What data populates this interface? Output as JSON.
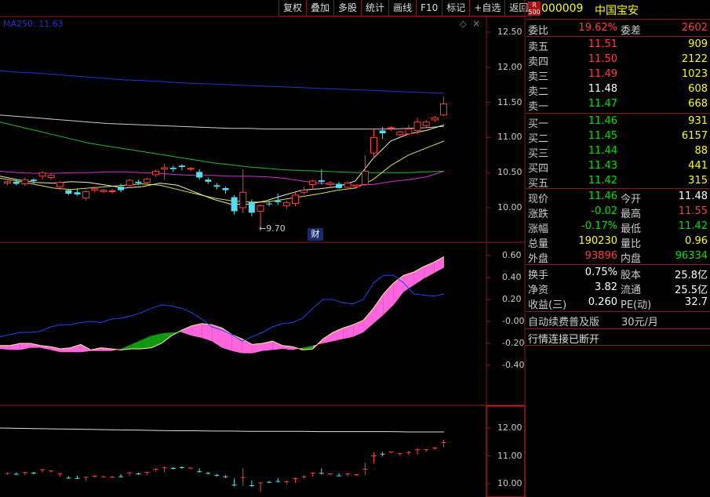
{
  "toolbar": [
    "复权",
    "叠加",
    "多股",
    "统计",
    "画线",
    "F10",
    "标记",
    "+自选",
    "返回"
  ],
  "stock": {
    "badge_top": "R",
    "badge_bottom": "500",
    "code": "000009",
    "name": "中国宝安"
  },
  "ma_legend": "MA250: 11.63",
  "low_marker": "←9.70",
  "cai_badge": "财",
  "price_axis": [
    "12.50",
    "12.00",
    "11.50",
    "11.00",
    "10.50",
    "10.00"
  ],
  "indicator_axis": [
    "0.60",
    "0.40",
    "0.20",
    "-0.00",
    "-0.20",
    "-0.40"
  ],
  "volume_axis": [
    "12.00",
    "11.00",
    "10.00"
  ],
  "order_book": {
    "weibi": {
      "label": "委比",
      "value": "19.62%",
      "label2": "委差",
      "value2": "2602"
    },
    "asks": [
      {
        "label": "卖五",
        "price": "11.51",
        "vol": "909"
      },
      {
        "label": "卖四",
        "price": "11.50",
        "vol": "2122"
      },
      {
        "label": "卖三",
        "price": "11.49",
        "vol": "1023"
      },
      {
        "label": "卖二",
        "price": "11.48",
        "vol": "608"
      },
      {
        "label": "卖一",
        "price": "11.47",
        "vol": "668"
      }
    ],
    "bids": [
      {
        "label": "买一",
        "price": "11.46",
        "vol": "931"
      },
      {
        "label": "买二",
        "price": "11.45",
        "vol": "6157"
      },
      {
        "label": "买三",
        "price": "11.44",
        "vol": "88"
      },
      {
        "label": "买四",
        "price": "11.43",
        "vol": "441"
      },
      {
        "label": "买五",
        "price": "11.42",
        "vol": "315"
      }
    ]
  },
  "quote": {
    "xianjia": {
      "k": "现价",
      "v": "11.46",
      "k2": "今开",
      "v2": "11.48"
    },
    "zhangdie": {
      "k": "涨跌",
      "v": "-0.02",
      "k2": "最高",
      "v2": "11.55"
    },
    "zhangfu": {
      "k": "涨幅",
      "v": "-0.17%",
      "k2": "最低",
      "v2": "11.42"
    },
    "zongliang": {
      "k": "总量",
      "v": "190230",
      "k2": "量比",
      "v2": "0.96"
    },
    "waipan": {
      "k": "外盘",
      "v": "93896",
      "k2": "内盘",
      "v2": "96334"
    }
  },
  "fundamentals": {
    "huanshou": {
      "k": "换手",
      "v": "0.75%",
      "k2": "股本",
      "v2": "25.8亿"
    },
    "jingzi": {
      "k": "净资",
      "v": "3.82",
      "k2": "流通",
      "v2": "25.5亿"
    },
    "shouyi": {
      "k": "收益(三)",
      "v": "0.260",
      "k2": "PE(动)",
      "v2": "32.7"
    }
  },
  "promo": {
    "text": "自动续费普及版",
    "price": "30元/月"
  },
  "status": "行情连接已断开",
  "candles": [
    [
      10.35,
      10.37,
      10.32,
      10.39
    ],
    [
      10.37,
      10.34,
      10.32,
      10.4
    ],
    [
      10.34,
      10.4,
      10.31,
      10.43
    ],
    [
      10.4,
      10.38,
      10.33,
      10.42
    ],
    [
      10.45,
      10.5,
      10.4,
      10.52
    ],
    [
      10.43,
      10.46,
      10.4,
      10.48
    ],
    [
      10.3,
      10.36,
      10.25,
      10.38
    ],
    [
      10.25,
      10.2,
      10.18,
      10.27
    ],
    [
      10.22,
      10.19,
      10.17,
      10.28
    ],
    [
      10.14,
      10.23,
      10.1,
      10.25
    ],
    [
      10.25,
      10.27,
      10.22,
      10.3
    ],
    [
      10.23,
      10.25,
      10.21,
      10.27
    ],
    [
      10.23,
      10.24,
      10.2,
      10.27
    ],
    [
      10.3,
      10.25,
      10.22,
      10.34
    ],
    [
      10.32,
      10.39,
      10.28,
      10.41
    ],
    [
      10.37,
      10.35,
      10.32,
      10.4
    ],
    [
      10.36,
      10.41,
      10.31,
      10.43
    ],
    [
      10.47,
      10.52,
      10.44,
      10.54
    ],
    [
      10.55,
      10.57,
      10.4,
      10.63
    ],
    [
      10.57,
      10.55,
      10.51,
      10.6
    ],
    [
      10.6,
      10.58,
      10.53,
      10.62
    ],
    [
      10.55,
      10.56,
      10.52,
      10.58
    ],
    [
      10.51,
      10.43,
      10.4,
      10.55
    ],
    [
      10.4,
      10.37,
      10.34,
      10.43
    ],
    [
      10.32,
      10.3,
      10.26,
      10.35
    ],
    [
      10.28,
      10.25,
      10.2,
      10.3
    ],
    [
      10.15,
      9.95,
      9.9,
      10.18
    ],
    [
      10.0,
      10.22,
      9.92,
      10.55
    ],
    [
      10.08,
      9.93,
      9.88,
      10.12
    ],
    [
      9.95,
      10.03,
      9.7,
      10.05
    ],
    [
      10.06,
      10.05,
      10.02,
      10.1
    ],
    [
      10.1,
      10.08,
      10.04,
      10.2
    ],
    [
      10.03,
      10.07,
      9.98,
      10.1
    ],
    [
      10.06,
      10.18,
      10.02,
      10.22
    ],
    [
      10.22,
      10.25,
      10.19,
      10.3
    ],
    [
      10.33,
      10.38,
      10.26,
      10.4
    ],
    [
      10.39,
      10.37,
      10.33,
      10.55
    ],
    [
      10.33,
      10.35,
      10.3,
      10.38
    ],
    [
      10.34,
      10.28,
      10.27,
      10.37
    ],
    [
      10.29,
      10.35,
      10.26,
      10.38
    ],
    [
      10.3,
      10.32,
      10.27,
      10.33
    ],
    [
      10.33,
      10.52,
      10.31,
      10.75
    ],
    [
      10.78,
      11.0,
      10.73,
      11.12
    ],
    [
      11.1,
      11.06,
      10.98,
      11.15
    ],
    [
      11.13,
      11.14,
      11.09,
      11.16
    ],
    [
      11.04,
      11.08,
      11.0,
      11.1
    ],
    [
      11.05,
      11.12,
      11.03,
      11.18
    ],
    [
      11.1,
      11.22,
      11.04,
      11.28
    ],
    [
      11.17,
      11.22,
      11.14,
      11.25
    ],
    [
      11.25,
      11.28,
      11.22,
      11.31
    ],
    [
      11.32,
      11.48,
      11.3,
      11.58
    ]
  ],
  "lines": {
    "ma250": [
      11.95,
      11.93,
      11.92,
      11.9,
      11.88,
      11.86,
      11.84,
      11.82,
      11.81,
      11.8,
      11.78,
      11.77,
      11.76,
      11.75,
      11.74,
      11.73,
      11.72,
      11.71,
      11.7,
      11.69,
      11.68,
      11.67,
      11.66,
      11.65,
      11.64,
      11.63
    ],
    "white": [
      11.32,
      11.3,
      11.28,
      11.26,
      11.24,
      11.22,
      11.2,
      11.19,
      11.18,
      11.17,
      11.16,
      11.15,
      11.14,
      11.13,
      11.13,
      11.12,
      11.12,
      11.12,
      11.12,
      11.12,
      11.12,
      11.12,
      11.12,
      11.13,
      11.14,
      11.16
    ],
    "green": [
      11.22,
      11.16,
      11.1,
      11.04,
      10.98,
      10.92,
      10.88,
      10.84,
      10.8,
      10.76,
      10.72,
      10.68,
      10.64,
      10.61,
      10.58,
      10.56,
      10.54,
      10.53,
      10.52,
      10.51,
      10.5,
      10.5,
      10.5,
      10.5,
      10.51,
      10.52
    ],
    "magenta": [
      10.52,
      10.5,
      10.49,
      10.49,
      10.5,
      10.5,
      10.51,
      10.51,
      10.5,
      10.49,
      10.47,
      10.46,
      10.46,
      10.45,
      10.45,
      10.44,
      10.42,
      10.38,
      10.35,
      10.33,
      10.32,
      10.33,
      10.37,
      10.4,
      10.44,
      10.52
    ],
    "yellow": [
      10.42,
      10.38,
      10.33,
      10.28,
      10.26,
      10.28,
      10.3,
      10.32,
      10.34,
      10.32,
      10.26,
      10.2,
      10.14,
      10.1,
      10.08,
      10.08,
      10.12,
      10.16,
      10.2,
      10.25,
      10.28,
      10.4,
      10.6,
      10.75,
      10.85,
      10.95
    ],
    "yellowfast": [
      10.45,
      10.4,
      10.36,
      10.35,
      10.37,
      10.36,
      10.32,
      10.28,
      10.3,
      10.35,
      10.32,
      10.22,
      10.12,
      10.05,
      10.05,
      10.1,
      10.18,
      10.25,
      10.27,
      10.3,
      10.38,
      10.7,
      10.95,
      11.05,
      11.1,
      11.18
    ]
  },
  "indicator": {
    "upper": [
      -0.22,
      -0.22,
      -0.2,
      -0.2,
      -0.22,
      -0.23,
      -0.25,
      -0.24,
      -0.21,
      -0.26,
      -0.24,
      -0.25,
      -0.26,
      -0.25,
      -0.25,
      -0.24,
      -0.2,
      -0.13,
      -0.08,
      -0.04,
      -0.02,
      -0.03,
      -0.06,
      -0.12,
      -0.16,
      -0.21,
      -0.2,
      -0.18,
      -0.22,
      -0.23,
      -0.26,
      -0.25,
      -0.16,
      -0.1,
      -0.06,
      -0.03,
      0.01,
      0.12,
      0.25,
      0.35,
      0.42,
      0.45,
      0.5,
      0.54,
      0.59
    ],
    "lower": [
      -0.25,
      -0.26,
      -0.26,
      -0.24,
      -0.24,
      -0.26,
      -0.28,
      -0.28,
      -0.28,
      -0.27,
      -0.27,
      -0.27,
      -0.25,
      -0.21,
      -0.17,
      -0.13,
      -0.11,
      -0.1,
      -0.1,
      -0.13,
      -0.15,
      -0.18,
      -0.24,
      -0.27,
      -0.29,
      -0.29,
      -0.27,
      -0.26,
      -0.25,
      -0.26,
      -0.24,
      -0.22,
      -0.2,
      -0.18,
      -0.16,
      -0.14,
      -0.1,
      -0.02,
      0.06,
      0.15,
      0.27,
      0.33,
      0.39,
      0.44,
      0.49
    ],
    "blue": [
      -0.14,
      -0.12,
      -0.1,
      -0.1,
      -0.09,
      -0.05,
      -0.03,
      -0.03,
      -0.01,
      0.0,
      -0.01,
      0.02,
      0.03,
      0.05,
      0.08,
      0.12,
      0.15,
      0.14,
      0.12,
      0.08,
      0.02,
      -0.05,
      -0.08,
      -0.12,
      -0.18,
      -0.14,
      -0.1,
      -0.05,
      -0.02,
      -0.01,
      0.03,
      0.12,
      0.2,
      0.2,
      0.17,
      0.16,
      0.2,
      0.35,
      0.42,
      0.42,
      0.35,
      0.25,
      0.24,
      0.23,
      0.25
    ]
  },
  "volume_line": [
    12.0,
    11.99,
    11.98,
    11.97,
    11.96,
    11.95,
    11.94,
    11.93,
    11.92,
    11.91,
    11.9,
    11.9,
    11.89,
    11.89,
    11.88,
    11.88,
    11.88,
    11.88,
    11.87,
    11.87,
    11.87,
    11.87,
    11.87,
    11.86,
    11.86,
    11.86
  ]
}
